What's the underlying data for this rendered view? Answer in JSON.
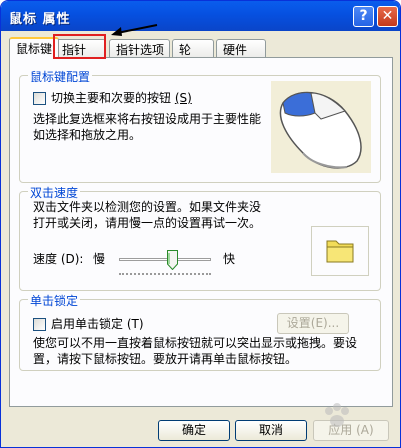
{
  "window": {
    "title": "鼠标 属性",
    "help_label": "?",
    "close_label": "✕"
  },
  "tabs": [
    "鼠标键",
    "指针",
    "指针选项",
    "轮",
    "硬件"
  ],
  "button_config": {
    "title": "鼠标键配置",
    "checkbox_label": "切换主要和次要的按钮",
    "checkbox_accel": "(S)",
    "checked": false,
    "desc_line1": "选择此复选框来将右按钮设成用于主要性能",
    "desc_line2": "如选择和拖放之用。"
  },
  "double_click": {
    "title": "双击速度",
    "desc_line1": "双击文件夹以检测您的设置。如果文件夹没",
    "desc_line2": "打开或关闭，请用慢一点的设置再试一次。",
    "speed_label": "速度 (D):",
    "slow_label": "慢",
    "fast_label": "快",
    "speed_value": 0.6
  },
  "click_lock": {
    "title": "单击锁定",
    "checkbox_label": "启用单击锁定 (T)",
    "checked": false,
    "settings_button": "设置(E)...",
    "desc_line1": "使您可以不用一直按着鼠标按钮就可以突出显示或拖拽。要设",
    "desc_line2": "置，请按下鼠标按钮。要放开请再单击鼠标按钮。"
  },
  "footer": {
    "ok": "确定",
    "cancel": "取消",
    "apply": "应用 (A)"
  },
  "watermark_text": "Bai 经验",
  "colors": {
    "title_bar": "#0650e0",
    "group_title": "#0046d5",
    "highlight": "#e02020"
  }
}
